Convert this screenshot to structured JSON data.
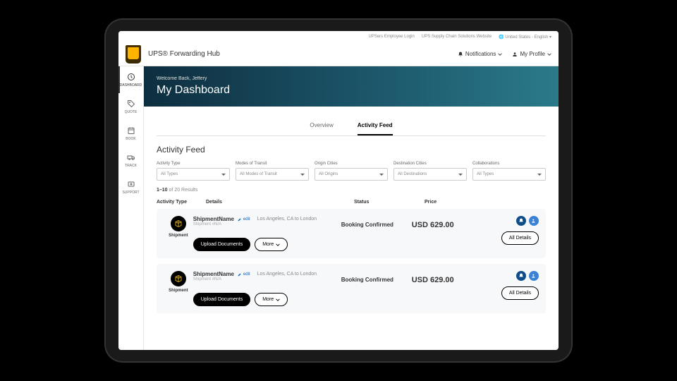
{
  "topbar": {
    "employee_login": "UPSers Employee Login",
    "scs_website": "UPS Supply Chain Solutions Website",
    "locale": "United States - English"
  },
  "header": {
    "brand": "UPS® Forwarding Hub",
    "notifications": "Notifications",
    "profile": "My Profile"
  },
  "sidebar": {
    "items": [
      {
        "label": "DASHBOARD"
      },
      {
        "label": "QUOTE"
      },
      {
        "label": "BOOK"
      },
      {
        "label": "TRACK"
      },
      {
        "label": "SUPPORT"
      }
    ]
  },
  "banner": {
    "welcome": "Welcome Back, Jeffery",
    "title": "My Dashboard"
  },
  "tabs": {
    "overview": "Overview",
    "activity": "Activity Feed"
  },
  "section": {
    "title": "Activity Feed",
    "filters": [
      {
        "label": "Activity Type",
        "value": "All Types"
      },
      {
        "label": "Modes of Transit",
        "value": "All Modes of Transit"
      },
      {
        "label": "Origin Cities",
        "value": "All Origins"
      },
      {
        "label": "Destination Cities",
        "value": "All Destinations"
      },
      {
        "label": "Collaborations",
        "value": "All Types"
      }
    ],
    "results_range": "1–10",
    "results_of": " of 20 Results",
    "columns": {
      "type": "Activity Type",
      "details": "Details",
      "status": "Status",
      "price": "Price"
    },
    "rows": [
      {
        "type_label": "Shipment",
        "name": "ShipmentName",
        "edit": "edit",
        "route": "Los Angeles, CA to London",
        "sub": "Shipment #N/A",
        "status": "Booking Confirmed",
        "price": "USD 629.00",
        "upload": "Upload Documents",
        "more": "More",
        "all_details": "All Details"
      },
      {
        "type_label": "Shipment",
        "name": "ShipmentName",
        "edit": "edit",
        "route": "Los Angeles, CA to London",
        "sub": "Shipment #N/A",
        "status": "Booking Confirmed",
        "price": "USD 629.00",
        "upload": "Upload Documents",
        "more": "More",
        "all_details": "All Details"
      }
    ]
  }
}
